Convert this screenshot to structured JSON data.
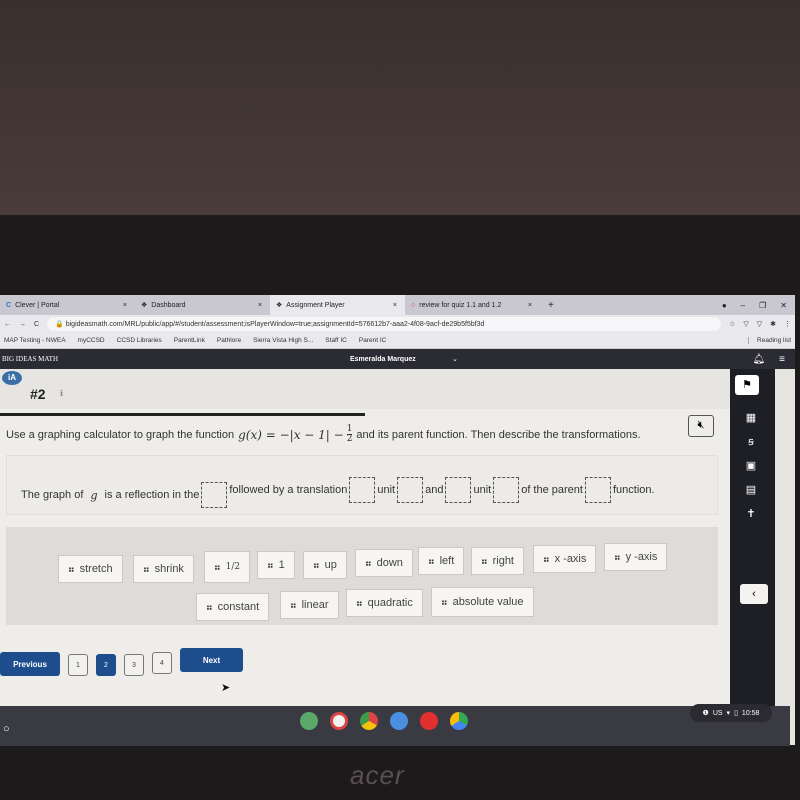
{
  "browser": {
    "tabs": [
      {
        "label": "Clever | Portal",
        "icon": "clever-icon"
      },
      {
        "label": "Dashboard",
        "icon": "bigideas-icon"
      },
      {
        "label": "Assignment Player",
        "icon": "bigideas-icon",
        "active": true
      },
      {
        "label": "review for quiz 1.1 and 1.2",
        "icon": "loading-icon"
      }
    ],
    "new_tab": "+",
    "url": "bigideasmath.com/MRL/public/app/#/student/assessment;isPlayerWindow=true;assignmentId=576612b7-aaa2-4f08-9acf-de29b5f5bf3d",
    "bookmarks": [
      "MAP Testing - NWEA",
      "myCCSD",
      "CCSD Libraries",
      "ParentLink",
      "Pathlore",
      "Sierra Vista High S...",
      "Staff IC",
      "Parent IC"
    ],
    "reading_list": "Reading list"
  },
  "app": {
    "brand": "BIG IDEAS MATH",
    "user": "Esmeralda Marquez",
    "question_number": "#2",
    "question": {
      "prefix": "Use a graphing calculator to graph the function",
      "function_lhs": "g(x) = −|x − 1| −",
      "frac_num": "1",
      "frac_den": "2",
      "suffix": "and its parent function. Then describe the transformations."
    },
    "sentence": {
      "p1": "The graph of",
      "var": "g",
      "p2": "is a reflection in the",
      "p3": "followed by a translation",
      "p4": "unit",
      "p5": "and",
      "p6": "unit",
      "p7": "of the parent",
      "p8": "function."
    },
    "tiles": [
      "stretch",
      "shrink",
      "1/2",
      "1",
      "up",
      "down",
      "left",
      "right",
      "x -axis",
      "y -axis",
      "constant",
      "linear",
      "quadratic",
      "absolute value"
    ],
    "nav": {
      "previous": "Previous",
      "next": "Next",
      "pages": [
        "1",
        "2",
        "3",
        "4"
      ],
      "current_page": "2"
    }
  },
  "system": {
    "locale": "US",
    "time": "10:58"
  },
  "hardware_brand": "acer",
  "colors": {
    "primary": "#1d4d8c",
    "sidebar": "#1e1f24"
  }
}
